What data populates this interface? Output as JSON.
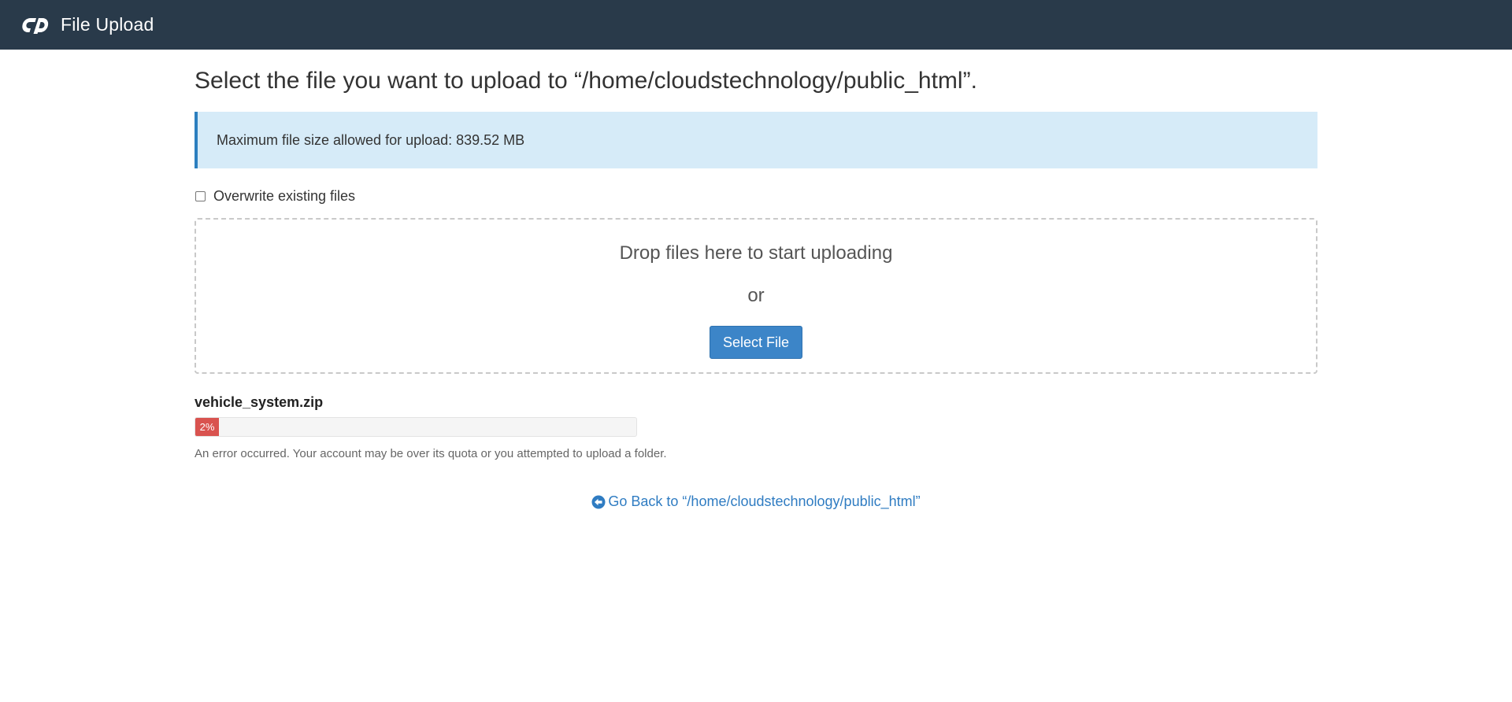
{
  "header": {
    "logo_icon": "cpanel-logo-icon",
    "title": "File Upload"
  },
  "main": {
    "page_title": "Select the file you want to upload to “/home/cloudstechnology/public_html”.",
    "info_message": "Maximum file size allowed for upload: 839.52 MB",
    "overwrite": {
      "label": "Overwrite existing files",
      "checked": false
    },
    "dropzone": {
      "drop_text": "Drop files here to start uploading",
      "or_text": "or",
      "select_button_label": "Select File"
    },
    "upload": {
      "file_name": "vehicle_system.zip",
      "progress_label": "2%",
      "progress_fraction": 0.02,
      "status_color": "#d9534f",
      "error_message": "An error occurred. Your account may be over its quota or you attempted to upload a folder."
    },
    "back_link": {
      "icon": "arrow-circle-left-icon",
      "label": "Go Back to “/home/cloudstechnology/public_html”"
    }
  },
  "colors": {
    "topbar": "#293a4a",
    "info_background": "#d6ebf8",
    "info_border": "#2c7fbf",
    "primary_button": "#3c85c8",
    "link": "#2f7cc2",
    "error": "#d9534f"
  }
}
